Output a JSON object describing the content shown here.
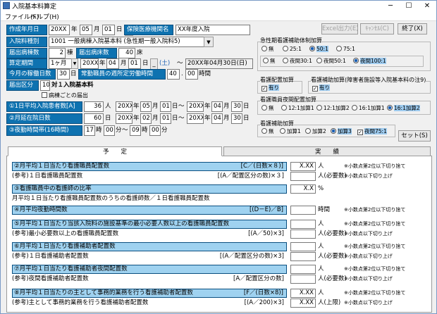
{
  "window": {
    "title": "入院基本料算定"
  },
  "menu": [
    "ファイル(F)",
    "ヘルプ(H)"
  ],
  "header": {
    "created_label": "作成年月日",
    "created": {
      "era": "20XX",
      "year_unit": "年",
      "month": "05",
      "month_unit": "月",
      "day": "01",
      "day_unit": "日",
      "dash": "_"
    },
    "insurer_label": "保険医療機関名",
    "insurer_value": "XX年度入院"
  },
  "buttons": {
    "excel": "Excel出力(E)",
    "cancel": "ｷｬﾝｾﾙ(C)",
    "exit": "終了(X)",
    "set": "セット(S)"
  },
  "fields": {
    "ward_type_label": "入院料種別",
    "ward_type_value": "1001 一般病棟入院基本料 (急性期一般入院料5)",
    "beds_label": "届出病棟数",
    "beds_value": "2",
    "beds_unit": "棟",
    "bed_count_label": "届出病床数",
    "bed_count_value": "40",
    "bed_count_unit": "床",
    "period_label": "算定期間",
    "period_value": "1ヶ月",
    "period_from": {
      "era": "20XX",
      "year_unit": "年",
      "month": "04",
      "month_unit": "月",
      "day": "01",
      "day_unit": "日",
      "dash": "_",
      "weekday": "(土)"
    },
    "period_tilde": "～",
    "period_to": "20XX年04月30日(日)",
    "workdays_label": "今月の稼働日数",
    "workdays_value": "30",
    "workdays_unit": "日",
    "fulltime_label": "常勤職員の週所定労働時間",
    "fulltime_value": "40",
    "fulltime_dot": ".",
    "fulltime_min": "00",
    "fulltime_unit": "時間",
    "division_label": "届出区分",
    "division_value": "10",
    "division_text": "対１入院基本料",
    "per_ward_check": "病棟ごとの届出"
  },
  "counts": [
    {
      "label": "①1日平均入院患者数[A]",
      "value": "36",
      "unit": "人",
      "from": {
        "era": "20XX",
        "y": "年",
        "m": "05",
        "mu": "月",
        "d": "01",
        "du": "日"
      },
      "to": {
        "era": "20XX",
        "y": "年",
        "m": "04",
        "mu": "月",
        "d": "30",
        "du": "日"
      }
    },
    {
      "label": "②月延在院日数",
      "value": "60",
      "unit": "日",
      "from": {
        "era": "20XX",
        "y": "年",
        "m": "02",
        "mu": "月",
        "d": "01",
        "du": "日"
      },
      "to": {
        "era": "20XX",
        "y": "年",
        "m": "04",
        "mu": "月",
        "d": "30",
        "du": "日"
      }
    },
    {
      "label": "③夜勤時間帯(16時間)",
      "night_from_h": "17",
      "h_unit": "時",
      "night_from_m": "00",
      "m_unit": "分",
      "tilde": "～",
      "night_to_h": "09",
      "night_to_m": "00"
    }
  ],
  "range_tilde": "～",
  "groups": {
    "emergency": {
      "title": "急性期看護補助体制加算",
      "options": [
        "無",
        "25:1",
        "50:1",
        "75:1",
        "無",
        "夜間30:1",
        "夜間50:1",
        "夜間100:1"
      ]
    },
    "nurse_place": {
      "title": "看護配置加算",
      "check": "有り"
    },
    "assist": {
      "title": "看護補助加算(障害者施設等入院基本料の注9)",
      "check": "有り"
    },
    "night_nurse": {
      "title": "看護職員夜間配置加算",
      "options": [
        "無",
        "12:1加算1",
        "12:1加算2",
        "16:1加算1",
        "16:1加算2"
      ]
    },
    "nursing_assist": {
      "title": "看護補助加算",
      "options": [
        "無",
        "加算1",
        "加算2",
        "加算3"
      ],
      "check": "夜間75:1"
    }
  },
  "tabs": {
    "left": "予　　定",
    "right": "実　　績"
  },
  "rows": [
    {
      "title": "②月平均１日当たり看護職員配置数",
      "formula": "[C／(日数×８)]",
      "sub": "(参考)１日看護職員配置数",
      "sub_formula": "[(A／配置区分の数)×３]",
      "v1": "X.XX",
      "u1": "人",
      "n1": "※小数点第2位以下切り捨て",
      "v2": "",
      "u2": "人(必要数)",
      "n2": "※小数点以下切り上げ"
    },
    {
      "title": "③看護職員中の看護師の比率",
      "formula": "",
      "sub": "月平均１日当たり看護職員配置数のうちの看護師数／１日看護職員配置数",
      "sub_formula": "",
      "v1": "X.X",
      "u1": "%",
      "n1": "",
      "v2": "",
      "u2": "",
      "n2": ""
    },
    {
      "title": "④月平均夜勤時間数",
      "formula": "[(D－E)／B]",
      "sub": "",
      "sub_formula": "",
      "v1": "",
      "u1": "時間",
      "n1": "※小数点第2位以下切り捨て",
      "v2": "",
      "u2": "",
      "n2": ""
    },
    {
      "title": "⑤月平均１日当たり当該入院料の施設基準の最小必要人数以上の看護職員配置数",
      "formula": "",
      "sub": "(参考)最小必要数以上の看護職員配置数",
      "sub_formula": "[(A／50)×3]",
      "v1": "",
      "u1": "人",
      "n1": "※小数点第2位以下切り捨て",
      "v2": "",
      "u2": "人(必要数)",
      "n2": "※小数点以下切り上げ"
    },
    {
      "title": "⑥月平均１日当たり看護補助者配置数",
      "formula": "",
      "sub": "(参考)１日看護補助者配置数",
      "sub_formula": "[(A／配置区分の数)×3]",
      "v1": "",
      "u1": "人",
      "n1": "※小数点第2位以下切り捨て",
      "v2": "",
      "u2": "人(必要数)",
      "n2": "※小数点以下切り上げ"
    },
    {
      "title": "⑦月平均１日当たり看護補助者夜間配置数",
      "formula": "",
      "sub": "(参考)夜間看護補助者配置数",
      "sub_formula": "[A／配置区分の数]",
      "v1": "",
      "u1": "人",
      "n1": "※小数点第2位以下切り捨て",
      "v2": "",
      "u2": "人(必要数)",
      "n2": "※小数点以下切り上げ"
    },
    {
      "title": "⑧月平均１日当たりの主として事務的業務を行う看護補助者配置数",
      "formula": "[F／(日数×8)]",
      "sub": "(参考)主として事務的業務を行う看護補助者配置数",
      "sub_formula": "[(A／200)×3]",
      "v1": "X.XX",
      "u1": "人",
      "n1": "※小数点第2位以下切り捨て",
      "v2": "X.XX",
      "u2": "人(上限)",
      "n2": "※小数点以下切り上げ"
    }
  ]
}
